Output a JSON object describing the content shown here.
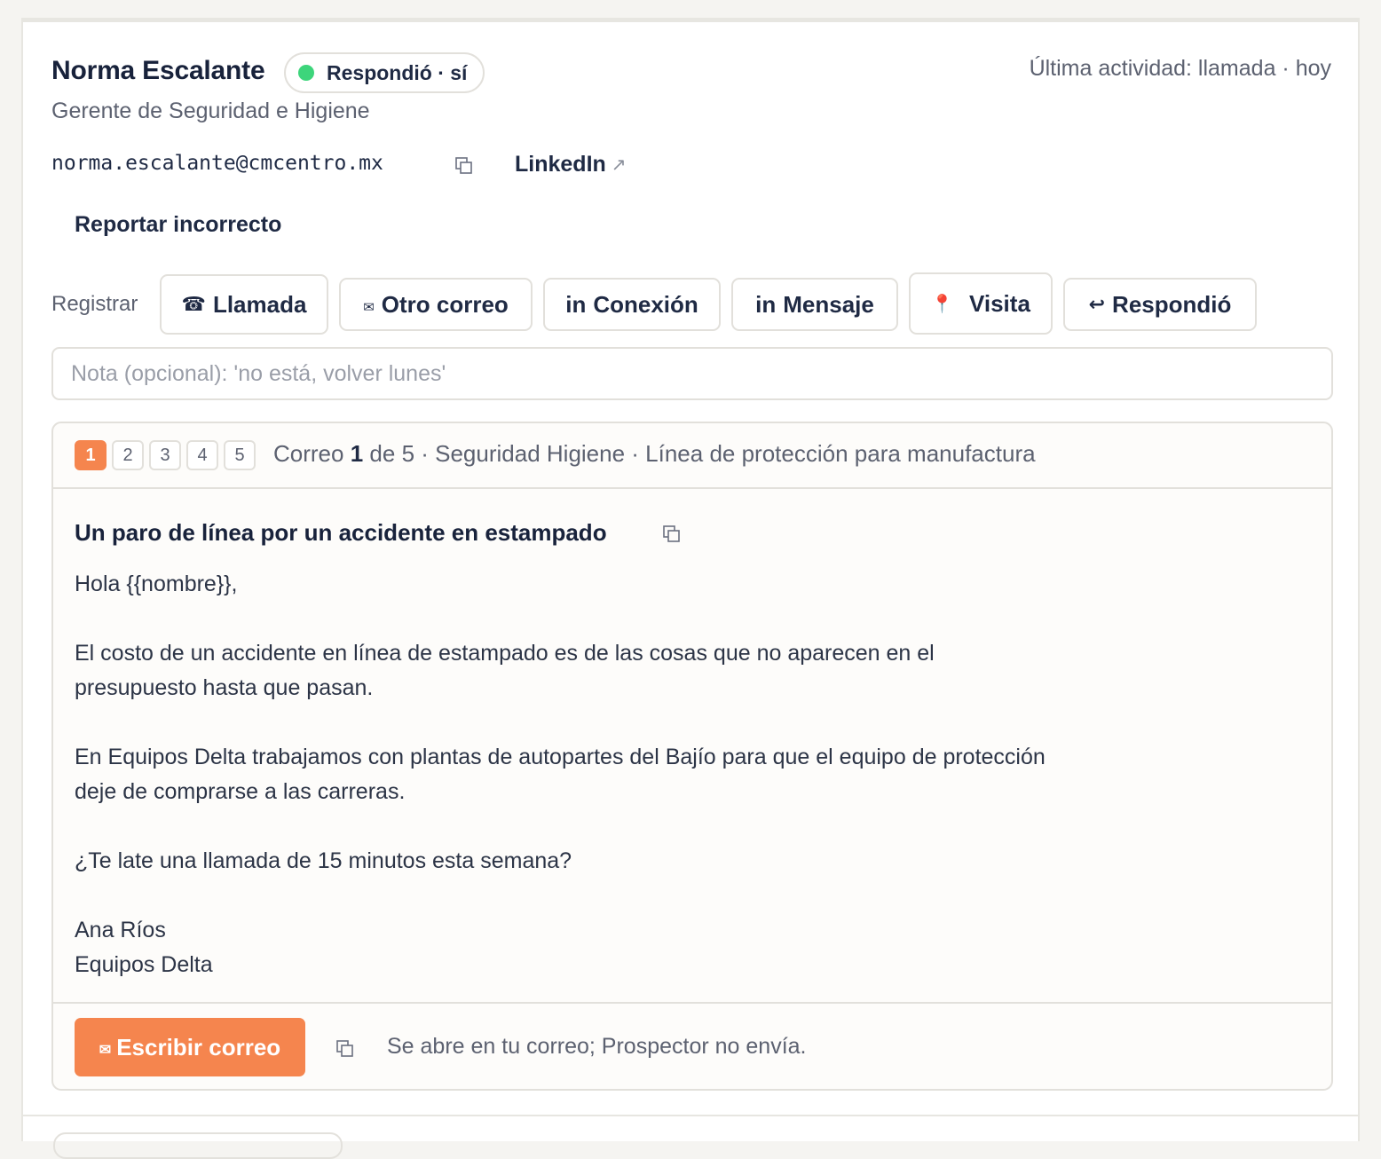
{
  "contact": {
    "name": "Norma Escalante",
    "status": "Respondió · sí",
    "status_color": "#3dd57b",
    "last_activity": "Última actividad: llamada · hoy",
    "title": "Gerente de Seguridad e Higiene",
    "email": "norma.escalante@cmcentro.mx",
    "linkedin_label": "LinkedIn",
    "linkedin_icon": "↗",
    "report_label": "Reportar incorrecto"
  },
  "register": {
    "label": "Registrar",
    "actions": [
      {
        "icon": "☎",
        "label": "Llamada"
      },
      {
        "icon": "✉",
        "label": "Otro correo"
      },
      {
        "icon": "in",
        "label": "Conexión"
      },
      {
        "icon": "in",
        "label": "Mensaje"
      },
      {
        "icon": "📍",
        "label": "Visita"
      },
      {
        "icon": "↩",
        "label": "Respondió"
      }
    ],
    "note_placeholder": "Nota (opcional): 'no está, volver lunes'"
  },
  "sequence": {
    "steps": [
      "1",
      "2",
      "3",
      "4",
      "5"
    ],
    "active_step": "1",
    "info_prefix": "Correo",
    "info_current": "1",
    "info_suffix": "de 5 · Seguridad Higiene · Línea de protección para manufactura"
  },
  "email": {
    "subject": "Un paro de línea por un accidente en estampado",
    "greeting": "Hola {{nombre}},",
    "paragraph1": "El costo de un accidente en línea de estampado es de las cosas que no aparecen en el presupuesto hasta que pasan.",
    "paragraph2": "En Equipos Delta trabajamos con plantas de autopartes del Bajío para que el equipo de protección deje de comprarse a las carreras.",
    "paragraph3": "¿Te late una llamada de 15 minutos esta semana?",
    "signature_name": "Ana Ríos",
    "signature_company": "Equipos Delta"
  },
  "footer": {
    "write_icon": "✉",
    "write_label": "Escribir correo",
    "note": "Se abre en tu correo; Prospector no envía."
  },
  "colors": {
    "accent": "#f5854e",
    "text": "#1f2a44",
    "muted": "#5c6170",
    "border": "#e2e0db"
  }
}
